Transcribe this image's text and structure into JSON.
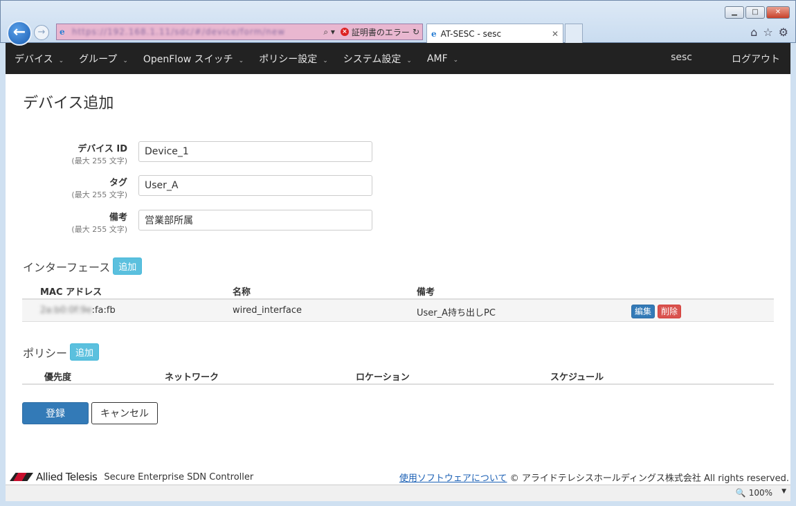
{
  "browser": {
    "url": "https://192.168.1.11/sdc/#/device/form/new",
    "cert_error": "証明書のエラー",
    "tab_title": "AT-SESC - sesc",
    "zoom": "100%"
  },
  "navbar": {
    "items": [
      {
        "label": "デバイス"
      },
      {
        "label": "グループ"
      },
      {
        "label": "OpenFlow スイッチ"
      },
      {
        "label": "ポリシー設定"
      },
      {
        "label": "システム設定"
      },
      {
        "label": "AMF"
      }
    ],
    "user": "sesc",
    "logout": "ログアウト"
  },
  "page": {
    "title": "デバイス追加",
    "fields": [
      {
        "label": "デバイス ID",
        "hint": "(最大 255 文字)",
        "value": "Device_1"
      },
      {
        "label": "タグ",
        "hint": "(最大 255 文字)",
        "value": "User_A"
      },
      {
        "label": "備考",
        "hint": "(最大 255 文字)",
        "value": "営業部所属"
      }
    ],
    "interfaces": {
      "heading": "インターフェース",
      "add_label": "追加",
      "columns": [
        "MAC アドレス",
        "名称",
        "備考"
      ],
      "rows": [
        {
          "mac_hidden": "2a:b0:0f:9e",
          "mac_visible": ":fa:fb",
          "name": "wired_interface",
          "note": "User_A持ち出しPC",
          "edit": "編集",
          "delete": "削除"
        }
      ]
    },
    "policies": {
      "heading": "ポリシー",
      "add_label": "追加",
      "columns": [
        "優先度",
        "ネットワーク",
        "ロケーション",
        "スケジュール"
      ]
    },
    "submit": "登録",
    "cancel": "キャンセル"
  },
  "footer": {
    "brand": "Allied Telesis",
    "product": "Secure Enterprise SDN Controller",
    "link": "使用ソフトウェアについて",
    "copyright": "© アライドテレシスホールディングス株式会社 All rights reserved."
  }
}
